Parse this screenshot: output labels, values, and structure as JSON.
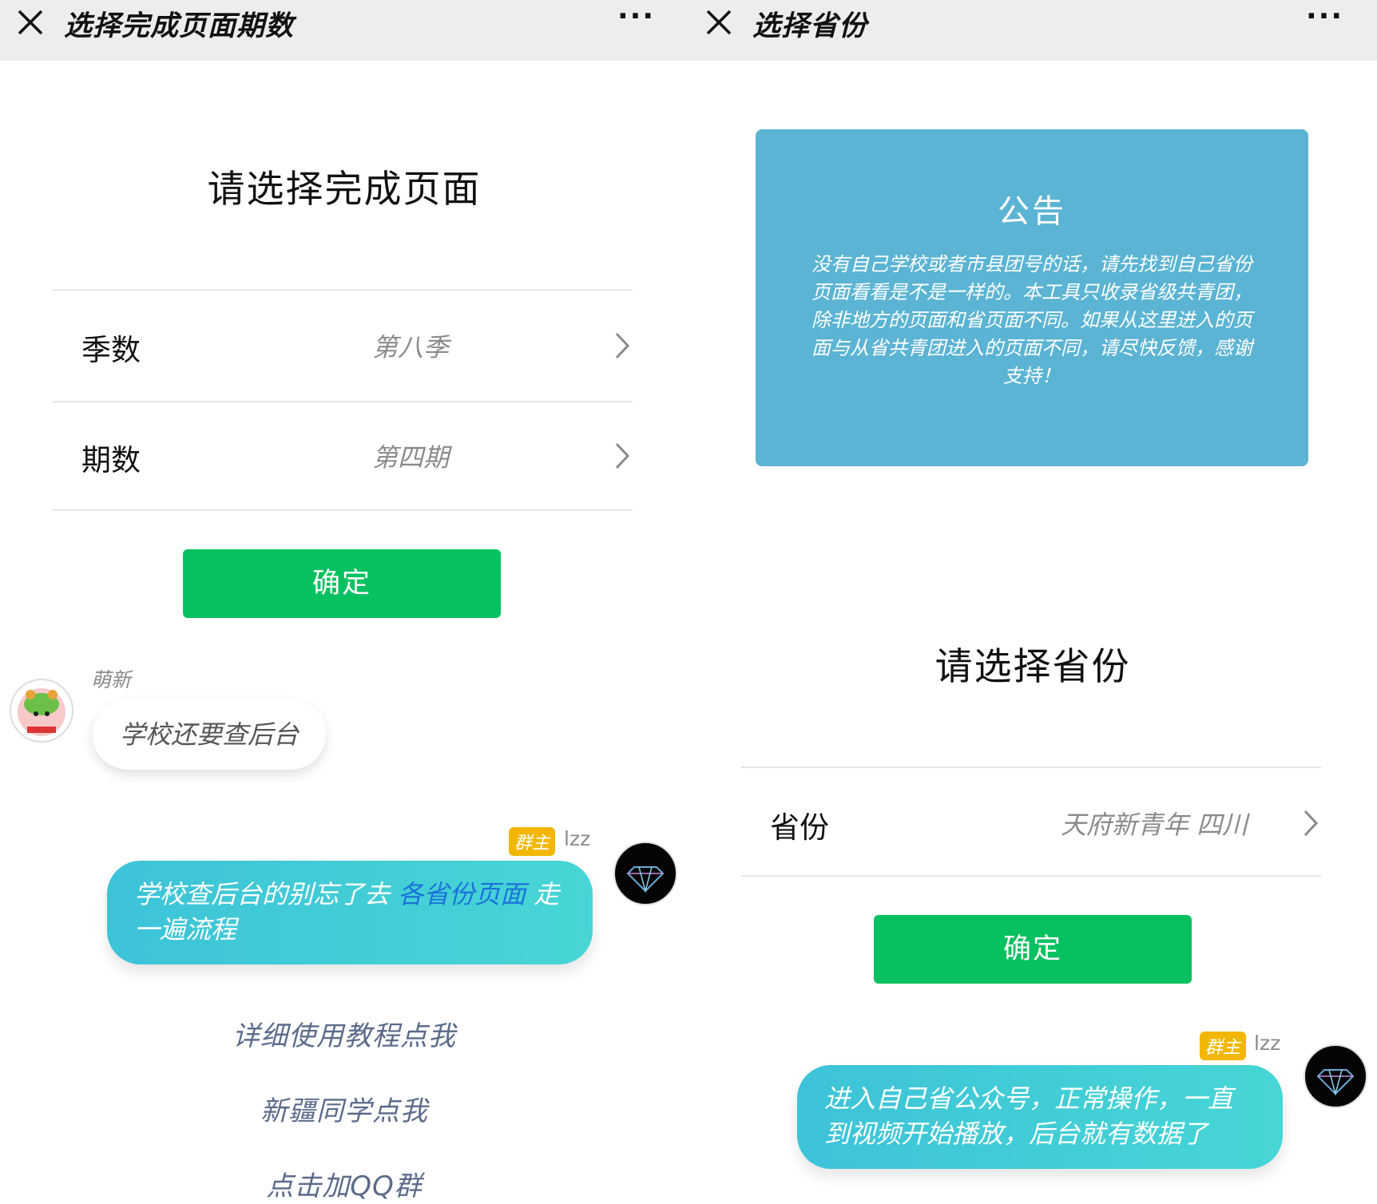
{
  "left": {
    "title": "选择完成页面期数",
    "more": "···",
    "heading": "请选择完成页面",
    "rows": [
      {
        "label": "季数",
        "value": "第八季"
      },
      {
        "label": "期数",
        "value": "第四期"
      }
    ],
    "confirm": "确定",
    "chat": {
      "incoming": {
        "sender": "萌新",
        "text": "学校还要查后台"
      },
      "outgoing": {
        "badge": "群主",
        "name": "lzz",
        "text_before": "学校查后台的别忘了去",
        "link": "各省份页面",
        "text_after": "走一遍流程"
      }
    },
    "links": [
      "详细使用教程点我",
      "新疆同学点我",
      "点击加QQ群"
    ]
  },
  "right": {
    "title": "选择省份",
    "more": "···",
    "notice": {
      "title": "公告",
      "body": "没有自己学校或者市县团号的话，请先找到自己省份页面看看是不是一样的。本工具只收录省级共青团，除非地方的页面和省页面不同。如果从这里进入的页面与从省共青团进入的页面不同，请尽快反馈，感谢支持！"
    },
    "heading": "请选择省份",
    "row": {
      "label": "省份",
      "value": "天府新青年 四川"
    },
    "confirm": "确定",
    "chat": {
      "badge": "群主",
      "name": "lzz",
      "text": "进入自己省公众号，正常操作，一直到视频开始播放，后台就有数据了"
    }
  },
  "colors": {
    "primary_green": "#07c160",
    "notice_blue": "#5bb4d3",
    "bubble_teal": "#43cfd6",
    "badge_yellow": "#f2b705",
    "link_text": "#5b6b8a"
  }
}
